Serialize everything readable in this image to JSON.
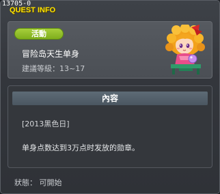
{
  "window": {
    "quest_id": "13705-0",
    "title": "QUEST INFO"
  },
  "quest": {
    "type_badge": "活動",
    "name": "冒险岛天生单身",
    "recommended_level": "建議等級：13~17",
    "npc_icon": "npc-girl-portrait-icon"
  },
  "content": {
    "header": "內容",
    "lines": [
      "[2013黑色日]",
      "单身点数达到3万点时发放的勋章。"
    ]
  },
  "status": {
    "text": "狀態： 可開始"
  },
  "colors": {
    "title": "#ffe400",
    "badge": "#8fbd28",
    "panel": "#4f5359",
    "header": "#54616b"
  }
}
